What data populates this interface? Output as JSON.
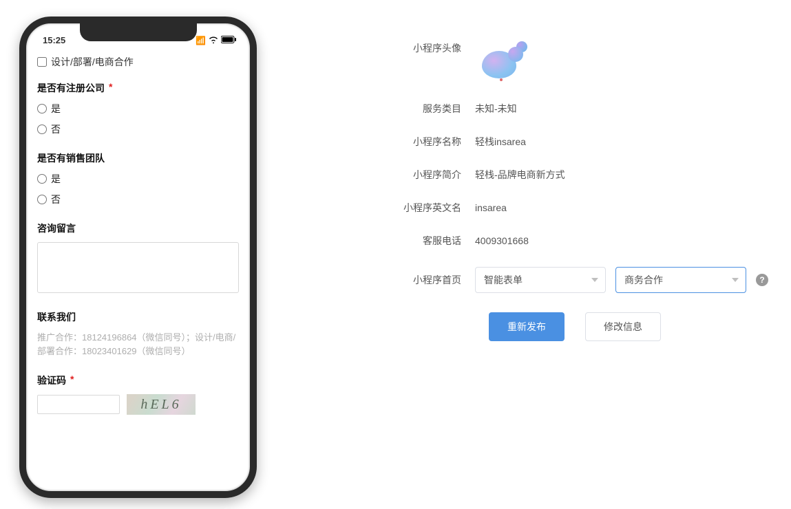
{
  "phone": {
    "time": "15:25",
    "checkbox_label": "设计/部署/电商合作",
    "section_company": {
      "label": "是否有注册公司",
      "required": true,
      "options": [
        "是",
        "否"
      ]
    },
    "section_sales": {
      "label": "是否有销售团队",
      "required": false,
      "options": [
        "是",
        "否"
      ]
    },
    "section_consult": {
      "label": "咨询留言"
    },
    "section_contact": {
      "label": "联系我们",
      "text": "推广合作：18124196864（微信同号）；设计/电商/部署合作：18023401629（微信同号）"
    },
    "section_captcha": {
      "label": "验证码",
      "required": true,
      "captcha_text": "hEL6"
    }
  },
  "panel": {
    "labels": {
      "avatar": "小程序头像",
      "category": "服务类目",
      "name": "小程序名称",
      "intro": "小程序简介",
      "enname": "小程序英文名",
      "phone": "客服电话",
      "home": "小程序首页"
    },
    "values": {
      "category": "未知-未知",
      "name": "轻栈insarea",
      "intro": "轻栈-品牌电商新方式",
      "enname": "insarea",
      "phone": "4009301668"
    },
    "selects": {
      "home1": "智能表单",
      "home2": "商务合作"
    },
    "buttons": {
      "republish": "重新发布",
      "edit": "修改信息"
    }
  }
}
